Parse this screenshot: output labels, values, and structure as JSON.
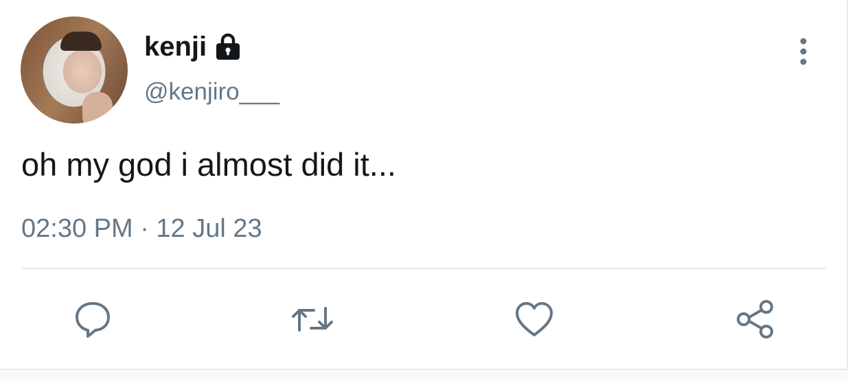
{
  "tweet": {
    "author": {
      "display_name": "kenji",
      "username": "@kenjiro___",
      "protected_icon": "lock-icon",
      "avatar": "profile-photo"
    },
    "text": "oh my god i almost did it...",
    "timestamp": "02:30 PM · 12 Jul 23",
    "menu_icon": "more-vertical-icon",
    "actions": [
      {
        "name": "reply",
        "icon": "comment-icon"
      },
      {
        "name": "retweet",
        "icon": "retweet-icon"
      },
      {
        "name": "like",
        "icon": "heart-icon"
      },
      {
        "name": "share",
        "icon": "share-icon"
      }
    ]
  },
  "colors": {
    "text": "#14171a",
    "secondary": "#657786",
    "divider": "#e6e9ec",
    "background": "#ffffff"
  }
}
